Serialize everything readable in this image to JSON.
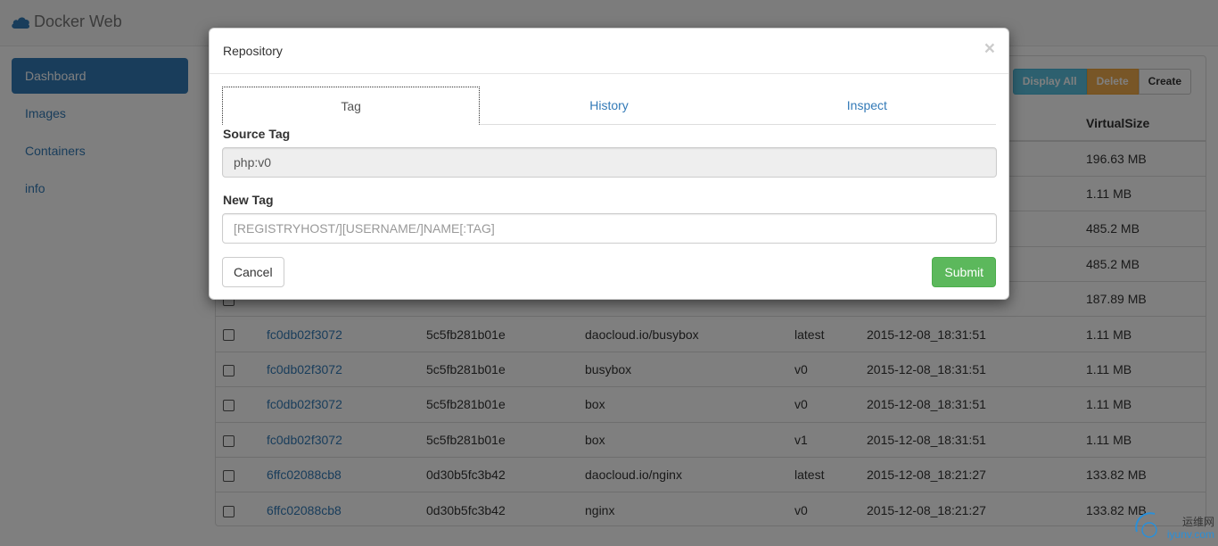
{
  "app": {
    "brand": "Docker Web",
    "brand_icon": "cloud-icon"
  },
  "sidebar": {
    "items": [
      {
        "label": "Dashboard",
        "active": true
      },
      {
        "label": "Images",
        "active": false
      },
      {
        "label": "Containers",
        "active": false
      },
      {
        "label": "info",
        "active": false
      }
    ]
  },
  "toolbar": {
    "display_all": "Display All",
    "delete": "Delete",
    "create": "Create"
  },
  "table": {
    "header_virtualsize": "VirtualSize",
    "rows": [
      {
        "id": "",
        "parent": "",
        "repo": "",
        "tag": "",
        "created": "",
        "size": "196.63 MB"
      },
      {
        "id": "",
        "parent": "",
        "repo": "",
        "tag": "",
        "created": "",
        "size": "1.11 MB"
      },
      {
        "id": "",
        "parent": "",
        "repo": "",
        "tag": "",
        "created": "",
        "size": "485.2 MB"
      },
      {
        "id": "",
        "parent": "",
        "repo": "",
        "tag": "",
        "created": "",
        "size": "485.2 MB"
      },
      {
        "id": "",
        "parent": "",
        "repo": "",
        "tag": "",
        "created": "",
        "size": "187.89 MB"
      },
      {
        "id": "fc0db02f3072",
        "parent": "5c5fb281b01e",
        "repo": "daocloud.io/busybox",
        "tag": "latest",
        "created": "2015-12-08_18:31:51",
        "size": "1.11 MB"
      },
      {
        "id": "fc0db02f3072",
        "parent": "5c5fb281b01e",
        "repo": "busybox",
        "tag": "v0",
        "created": "2015-12-08_18:31:51",
        "size": "1.11 MB"
      },
      {
        "id": "fc0db02f3072",
        "parent": "5c5fb281b01e",
        "repo": "box",
        "tag": "v0",
        "created": "2015-12-08_18:31:51",
        "size": "1.11 MB"
      },
      {
        "id": "fc0db02f3072",
        "parent": "5c5fb281b01e",
        "repo": "box",
        "tag": "v1",
        "created": "2015-12-08_18:31:51",
        "size": "1.11 MB"
      },
      {
        "id": "6ffc02088cb8",
        "parent": "0d30b5fc3b42",
        "repo": "daocloud.io/nginx",
        "tag": "latest",
        "created": "2015-12-08_18:21:27",
        "size": "133.82 MB"
      },
      {
        "id": "6ffc02088cb8",
        "parent": "0d30b5fc3b42",
        "repo": "nginx",
        "tag": "v0",
        "created": "2015-12-08_18:21:27",
        "size": "133.82 MB"
      }
    ]
  },
  "modal": {
    "title": "Repository",
    "close_glyph": "×",
    "tabs": [
      {
        "label": "Tag",
        "active": true
      },
      {
        "label": "History",
        "active": false
      },
      {
        "label": "Inspect",
        "active": false
      }
    ],
    "source_tag_label": "Source Tag",
    "source_tag_value": "php:v0",
    "new_tag_label": "New Tag",
    "new_tag_placeholder": "[REGISTRYHOST/][USERNAME/]NAME[:TAG]",
    "cancel": "Cancel",
    "submit": "Submit"
  },
  "watermark": {
    "cn": "运维网",
    "en": "iyunv.com"
  },
  "colors": {
    "primary": "#337ab7",
    "info": "#5bc0de",
    "warning": "#f0ad4e",
    "success": "#5cb85c"
  }
}
